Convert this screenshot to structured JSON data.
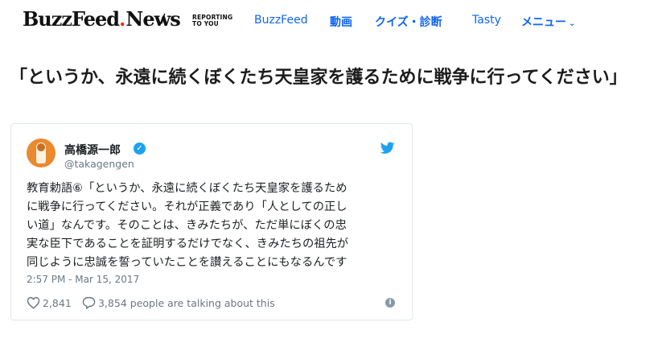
{
  "header": {
    "logo": {
      "buzz": "BuzzFeed",
      "news": "News"
    },
    "slash": "/",
    "tagline_line1": "REPORTING",
    "tagline_line2": "TO YOU",
    "nav": [
      {
        "label": "BuzzFeed"
      },
      {
        "label": "動画"
      },
      {
        "label": "クイズ・診断"
      },
      {
        "label": "Tasty"
      },
      {
        "label": "メニュー"
      }
    ],
    "nav_chevron": "⌄"
  },
  "article": {
    "title": "「というか、永遠に続くぼくたち天皇家を護るために戦争に行ってください」"
  },
  "tweet": {
    "user_name": "高橋源一郎",
    "handle": "@takagengen",
    "text_lines": [
      "教育勅語⑥「というか、永遠に続くぼくたち天皇家を護るため",
      "に戦争に行ってください。それが正義であり「人としての正し",
      "い道」なんです。そのことは、きみたちが、ただ単にぼくの忠",
      "実な臣下であることを証明するだけでなく、きみたちの祖先が",
      "同じように忠誠を誓っていたことを讃えることにもなるんです"
    ],
    "timestamp": "2:57 PM - Mar 15, 2017",
    "like_count": "2,841",
    "talk_text": "3,854 people are talking about this",
    "info_glyph": "i",
    "verified_glyph": "✓"
  },
  "colors": {
    "nav_link": "#0f65ef",
    "logo_dot": "#ee3322",
    "twitter_blue": "#1da1f2",
    "muted": "#697882"
  }
}
